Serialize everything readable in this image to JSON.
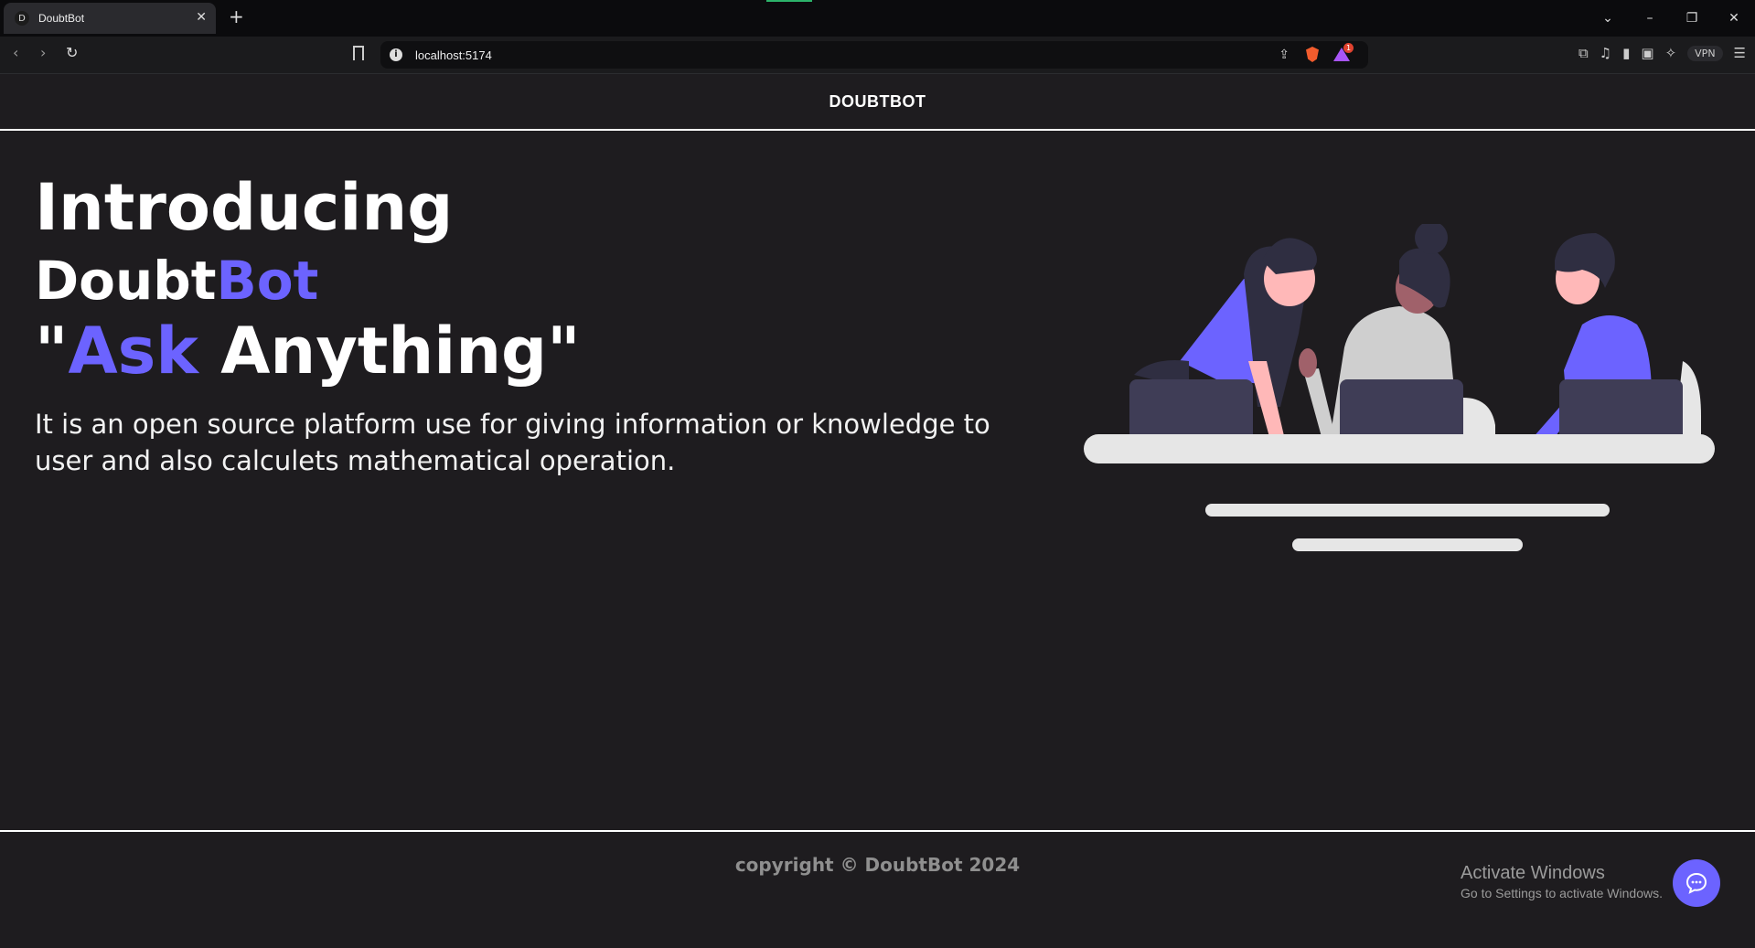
{
  "browser": {
    "tab_title": "DoubtBot",
    "tab_favicon_letter": "D",
    "new_tab_symbol": "+",
    "url": "localhost:5174",
    "vpn_label": "VPN",
    "rewards_badge": "1"
  },
  "header": {
    "brand": "DOUBTBOT"
  },
  "hero": {
    "title": "Introducing",
    "name_part1": "Doubt",
    "name_part2": "Bot",
    "quote_open": "\"",
    "quote_accent": "Ask",
    "quote_rest": " Anything",
    "quote_close": "\"",
    "description": "It is an open source platform use for giving information or knowledge to user and also calculets mathematical operation."
  },
  "footer": {
    "copyright": "copyright © DoubtBot 2024"
  },
  "watermark": {
    "line1": "Activate Windows",
    "line2": "Go to Settings to activate Windows."
  },
  "colors": {
    "accent": "#6c63ff",
    "background": "#1e1c1f"
  },
  "icons": [
    "back-icon",
    "forward-icon",
    "reload-icon",
    "bookmark-icon",
    "info-icon",
    "share-icon",
    "brave-shield-icon",
    "rewards-icon",
    "extensions-icon",
    "media-icon",
    "sidebar-icon",
    "wallet-icon",
    "leo-icon",
    "menu-icon",
    "chat-icon"
  ]
}
